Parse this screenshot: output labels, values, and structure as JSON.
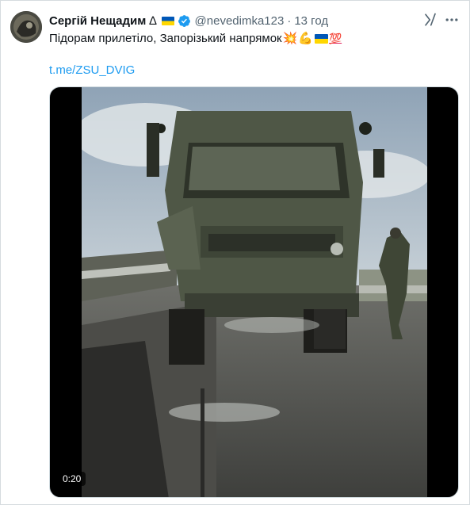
{
  "tweet": {
    "author_name": "Сергій Нещадим",
    "name_symbol": "∆",
    "handle": "@nevedimka123",
    "separator": "·",
    "time": "13 год",
    "text": "Підорам прилетіло, Запорізький напрямок",
    "text_emojis": [
      "💥",
      "💪",
      "🇺🇦",
      "💯"
    ],
    "link": "t.me/ZSU_DVIG"
  },
  "video": {
    "duration": "0:20",
    "description_icons": [
      "play-area"
    ]
  },
  "colors": {
    "link": "#1d9bf0",
    "secondary_text": "#536471",
    "verified": "#1d9bf0",
    "flag_blue": "#0057b7",
    "flag_yellow": "#ffd700"
  }
}
